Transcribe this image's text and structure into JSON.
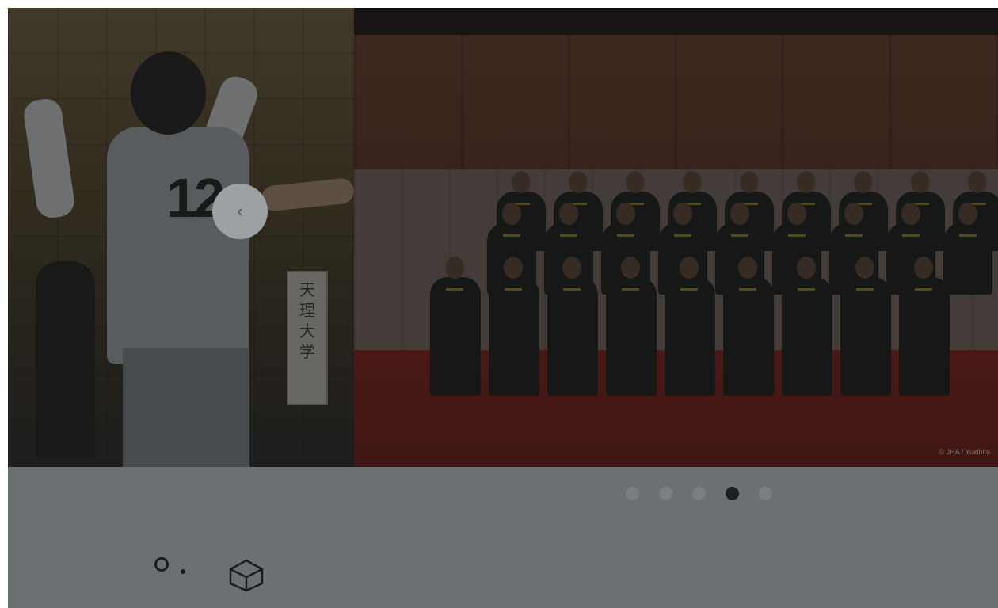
{
  "slider": {
    "prev_slide": {
      "jersey_number": "12",
      "banner_text": "天\n理\n大\n学"
    },
    "current_slide": {
      "photo_credit": "© JHA / Yukihito"
    },
    "prev_button_icon": "chevron-left-icon",
    "prev_button_glyph": "‹",
    "pagination": {
      "count": 5,
      "active_index": 3
    }
  },
  "decorations": [
    "circle-icon",
    "dot-icon",
    "cube-icon"
  ],
  "colors": {
    "overlay": "#6b7172",
    "dot_inactive": "#7a8081",
    "dot_active": "#1e2122"
  }
}
